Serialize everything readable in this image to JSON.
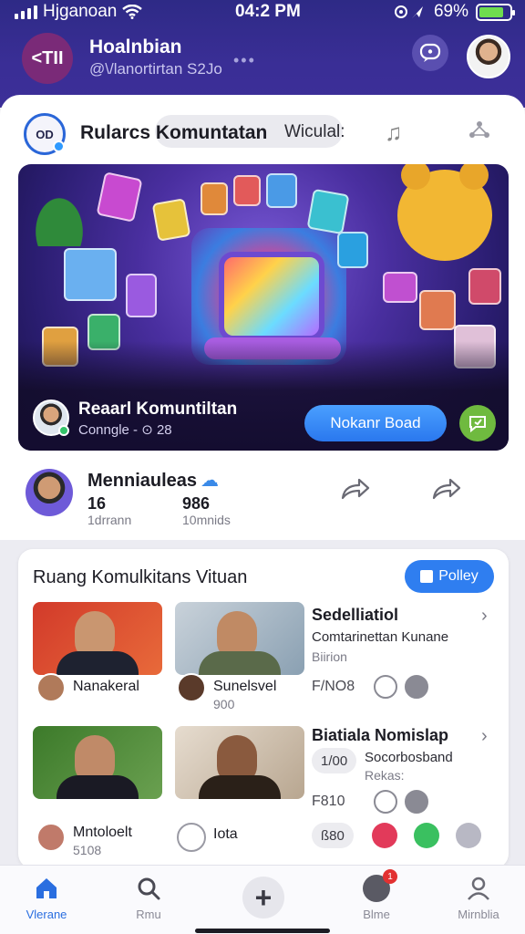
{
  "status_bar": {
    "carrier": "Hjganoan",
    "time": "04:2 PM",
    "battery": "69%",
    "battery_level": 0.69
  },
  "header": {
    "back_label": "<TII",
    "title": "Hoalnbian",
    "subtitle": "@\\/lanortirtan S2Jo",
    "dots": "•••",
    "message_icon": "chat-bubble-icon",
    "avatar_icon": "user-avatar"
  },
  "group": {
    "icon_text": "OD",
    "name": "Rularcs Komuntatan",
    "topic": "Wiculal:",
    "music_icon": "music-note-icon",
    "settings_icon": "share-nodes-icon"
  },
  "hero": {
    "title": "Reaarl Komuntiltan",
    "subtitle": "Conngle - ⊙ 28",
    "join_label": "Nokanr Boad",
    "action_icon": "chat-icon"
  },
  "members": {
    "title": "Menniauleas",
    "stat1_value": "16",
    "stat1_label": "1drrann",
    "stat2_value": "986",
    "stat2_label": "10mnids"
  },
  "community": {
    "title": "Ruang Komulkitans Vituan",
    "follow_label": "Polley",
    "posts": [
      {
        "user_name": "Nanakeral",
        "title": "Sedelliatiol",
        "line": "Comtarinettan Kunane",
        "muted": "Biirion"
      },
      {
        "user_name": "Sunelsvel",
        "user_sub": "900",
        "stat": "F/NO8"
      },
      {
        "user_name": "Mntoloelt",
        "user_sub": "5108",
        "title": "Biatiala Nomislap",
        "pill": "1/00",
        "line": "Socorbosband",
        "muted": "Rekas:"
      },
      {
        "user_name": "Iota",
        "stat": "F810",
        "pill": "ß80"
      }
    ]
  },
  "bottom_nav": {
    "items": [
      {
        "label": "Vlerane",
        "icon": "home-icon"
      },
      {
        "label": "Rmu",
        "icon": "search-icon"
      },
      {
        "label": "",
        "icon": "plus-icon"
      },
      {
        "label": "Blme",
        "icon": "notification-icon"
      },
      {
        "label": "Mirnblia",
        "icon": "profile-icon"
      }
    ],
    "badge": "1"
  },
  "colors": {
    "header_bg": "#2e2a86",
    "accent_blue": "#2f7ef0",
    "back_button": "#7a2a78",
    "online_green": "#34c36a"
  }
}
